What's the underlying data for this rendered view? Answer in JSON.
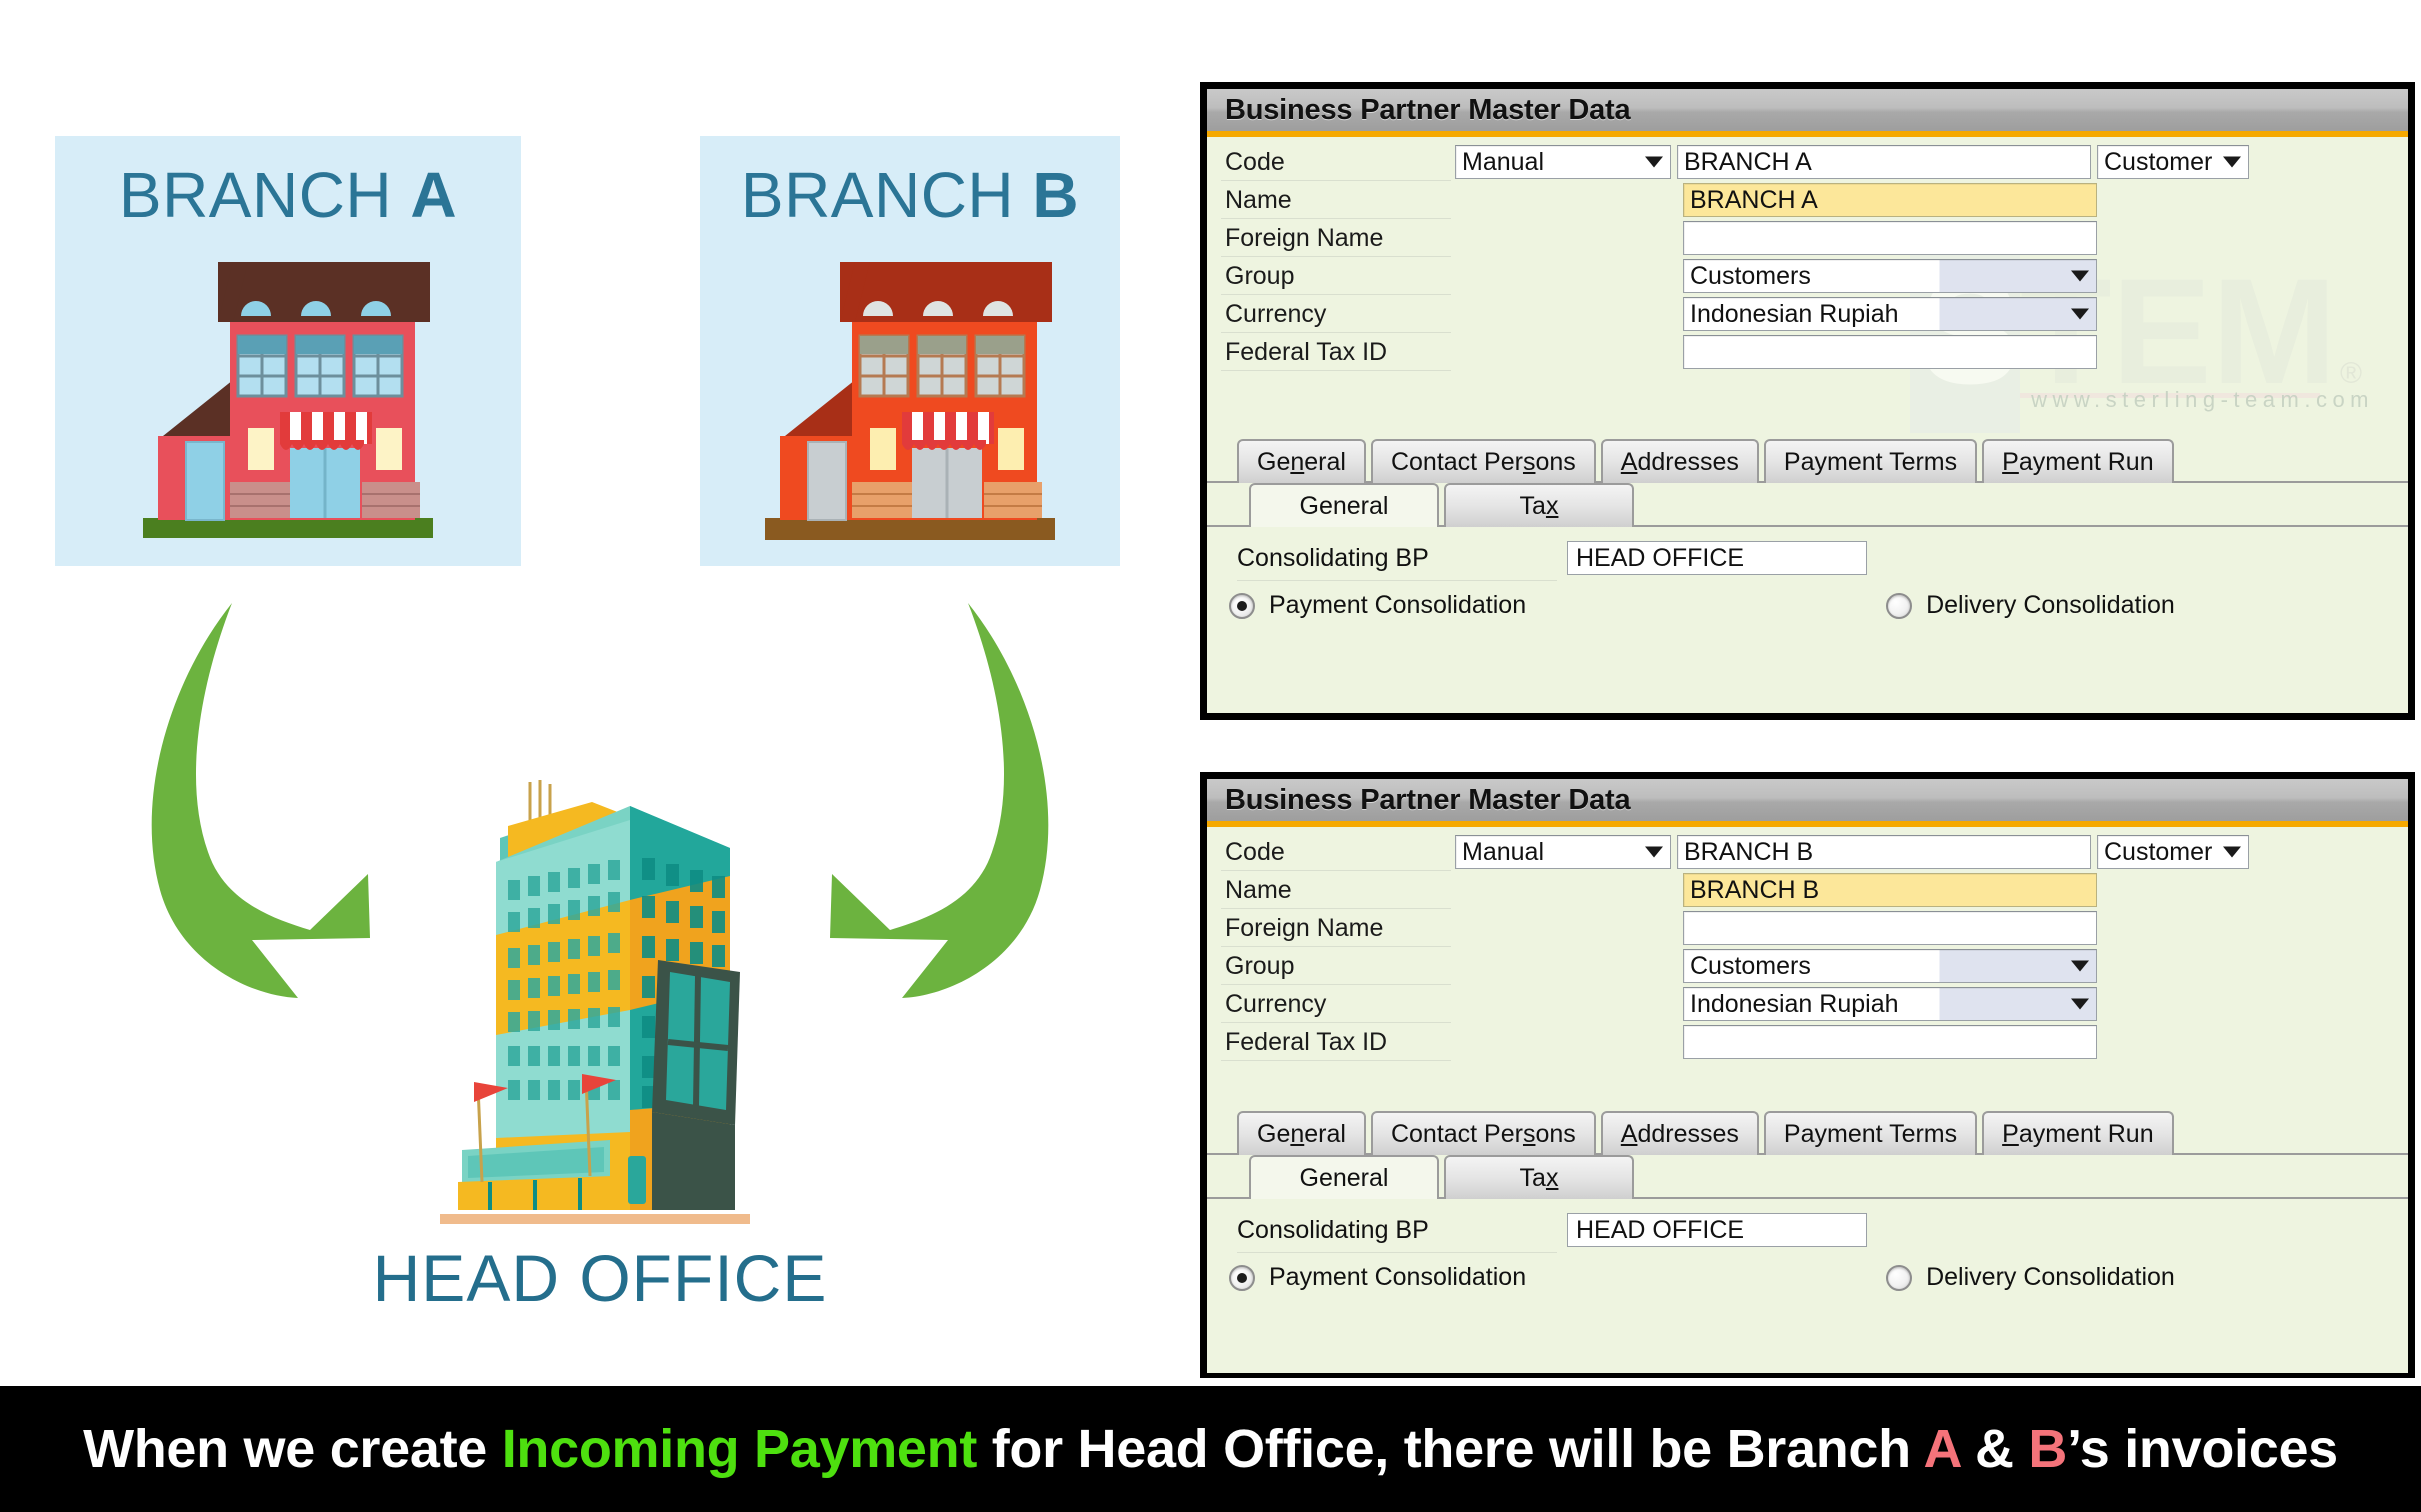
{
  "diagram": {
    "branch_a": {
      "label_prefix": "BRANCH ",
      "label_letter": "A",
      "icon": "shop-building-pink"
    },
    "branch_b": {
      "label_prefix": "BRANCH ",
      "label_letter": "B",
      "icon": "shop-building-orange"
    },
    "head_office": {
      "label": "HEAD OFFICE",
      "icon": "skyscraper-building"
    },
    "arrow_left_icon": "curved-arrow-down-right",
    "arrow_right_icon": "curved-arrow-down-left",
    "panel_color": "#d7edf8",
    "label_color": "#2b7596",
    "arrow_color": "#6cb33f"
  },
  "forms": [
    {
      "id": "form-a",
      "title": "Business Partner Master Data",
      "fields": {
        "code_label": "Code",
        "code_mode": "Manual",
        "code_value": "BRANCH A",
        "partner_type": "Customer",
        "name_label": "Name",
        "name_value": "BRANCH A",
        "foreign_name_label": "Foreign Name",
        "foreign_name_value": "",
        "group_label": "Group",
        "group_value": "Customers",
        "currency_label": "Currency",
        "currency_value": "Indonesian Rupiah",
        "federal_tax_label": "Federal Tax ID",
        "federal_tax_value": ""
      },
      "tabs": [
        {
          "pre": "Ge",
          "mn": "n",
          "post": "eral",
          "active": false
        },
        {
          "pre": "Contact Per",
          "mn": "s",
          "post": "ons",
          "active": false
        },
        {
          "pre": "",
          "mn": "A",
          "post": "ddresses",
          "active": false
        },
        {
          "pre": "Payment Terms",
          "mn": "",
          "post": "",
          "active": false
        },
        {
          "pre": "",
          "mn": "P",
          "post": "ayment Run",
          "active": false
        }
      ],
      "subtabs": [
        {
          "pre": "General",
          "mn": "",
          "post": "",
          "active": true
        },
        {
          "pre": "Ta",
          "mn": "x",
          "post": "",
          "active": false
        }
      ],
      "consolidating_bp_label": "Consolidating BP",
      "consolidating_bp_value": "HEAD OFFICE",
      "payment_consolidation_label": "Payment Consolidation",
      "payment_consolidation_selected": true,
      "delivery_consolidation_label": "Delivery Consolidation",
      "delivery_consolidation_selected": false
    },
    {
      "id": "form-b",
      "title": "Business Partner Master Data",
      "fields": {
        "code_label": "Code",
        "code_mode": "Manual",
        "code_value": "BRANCH B",
        "partner_type": "Customer",
        "name_label": "Name",
        "name_value": "BRANCH B",
        "foreign_name_label": "Foreign Name",
        "foreign_name_value": "",
        "group_label": "Group",
        "group_value": "Customers",
        "currency_label": "Currency",
        "currency_value": "Indonesian Rupiah",
        "federal_tax_label": "Federal Tax ID",
        "federal_tax_value": ""
      },
      "tabs": [
        {
          "pre": "Ge",
          "mn": "n",
          "post": "eral",
          "active": false
        },
        {
          "pre": "Contact Per",
          "mn": "s",
          "post": "ons",
          "active": false
        },
        {
          "pre": "",
          "mn": "A",
          "post": "ddresses",
          "active": false
        },
        {
          "pre": "Payment Terms",
          "mn": "",
          "post": "",
          "active": false
        },
        {
          "pre": "",
          "mn": "P",
          "post": "ayment Run",
          "active": false
        }
      ],
      "subtabs": [
        {
          "pre": "General",
          "mn": "",
          "post": "",
          "active": true
        },
        {
          "pre": "Ta",
          "mn": "x",
          "post": "",
          "active": false
        }
      ],
      "consolidating_bp_label": "Consolidating BP",
      "consolidating_bp_value": "HEAD OFFICE",
      "payment_consolidation_label": "Payment Consolidation",
      "payment_consolidation_selected": true,
      "delivery_consolidation_label": "Delivery Consolidation",
      "delivery_consolidation_selected": false
    }
  ],
  "watermark": {
    "logo_text": "STEM",
    "registered_mark": "®",
    "url": "www.sterling-team.com"
  },
  "caption": {
    "part1": "When we create ",
    "highlight1": "Incoming Payment",
    "part2": " for Head Office, there will be Branch ",
    "highlight2": "A",
    "part3": " & ",
    "highlight3": "B",
    "part4": "’s invoices",
    "highlight1_color": "#4ee00f",
    "highlight2_color": "#f4737a"
  }
}
